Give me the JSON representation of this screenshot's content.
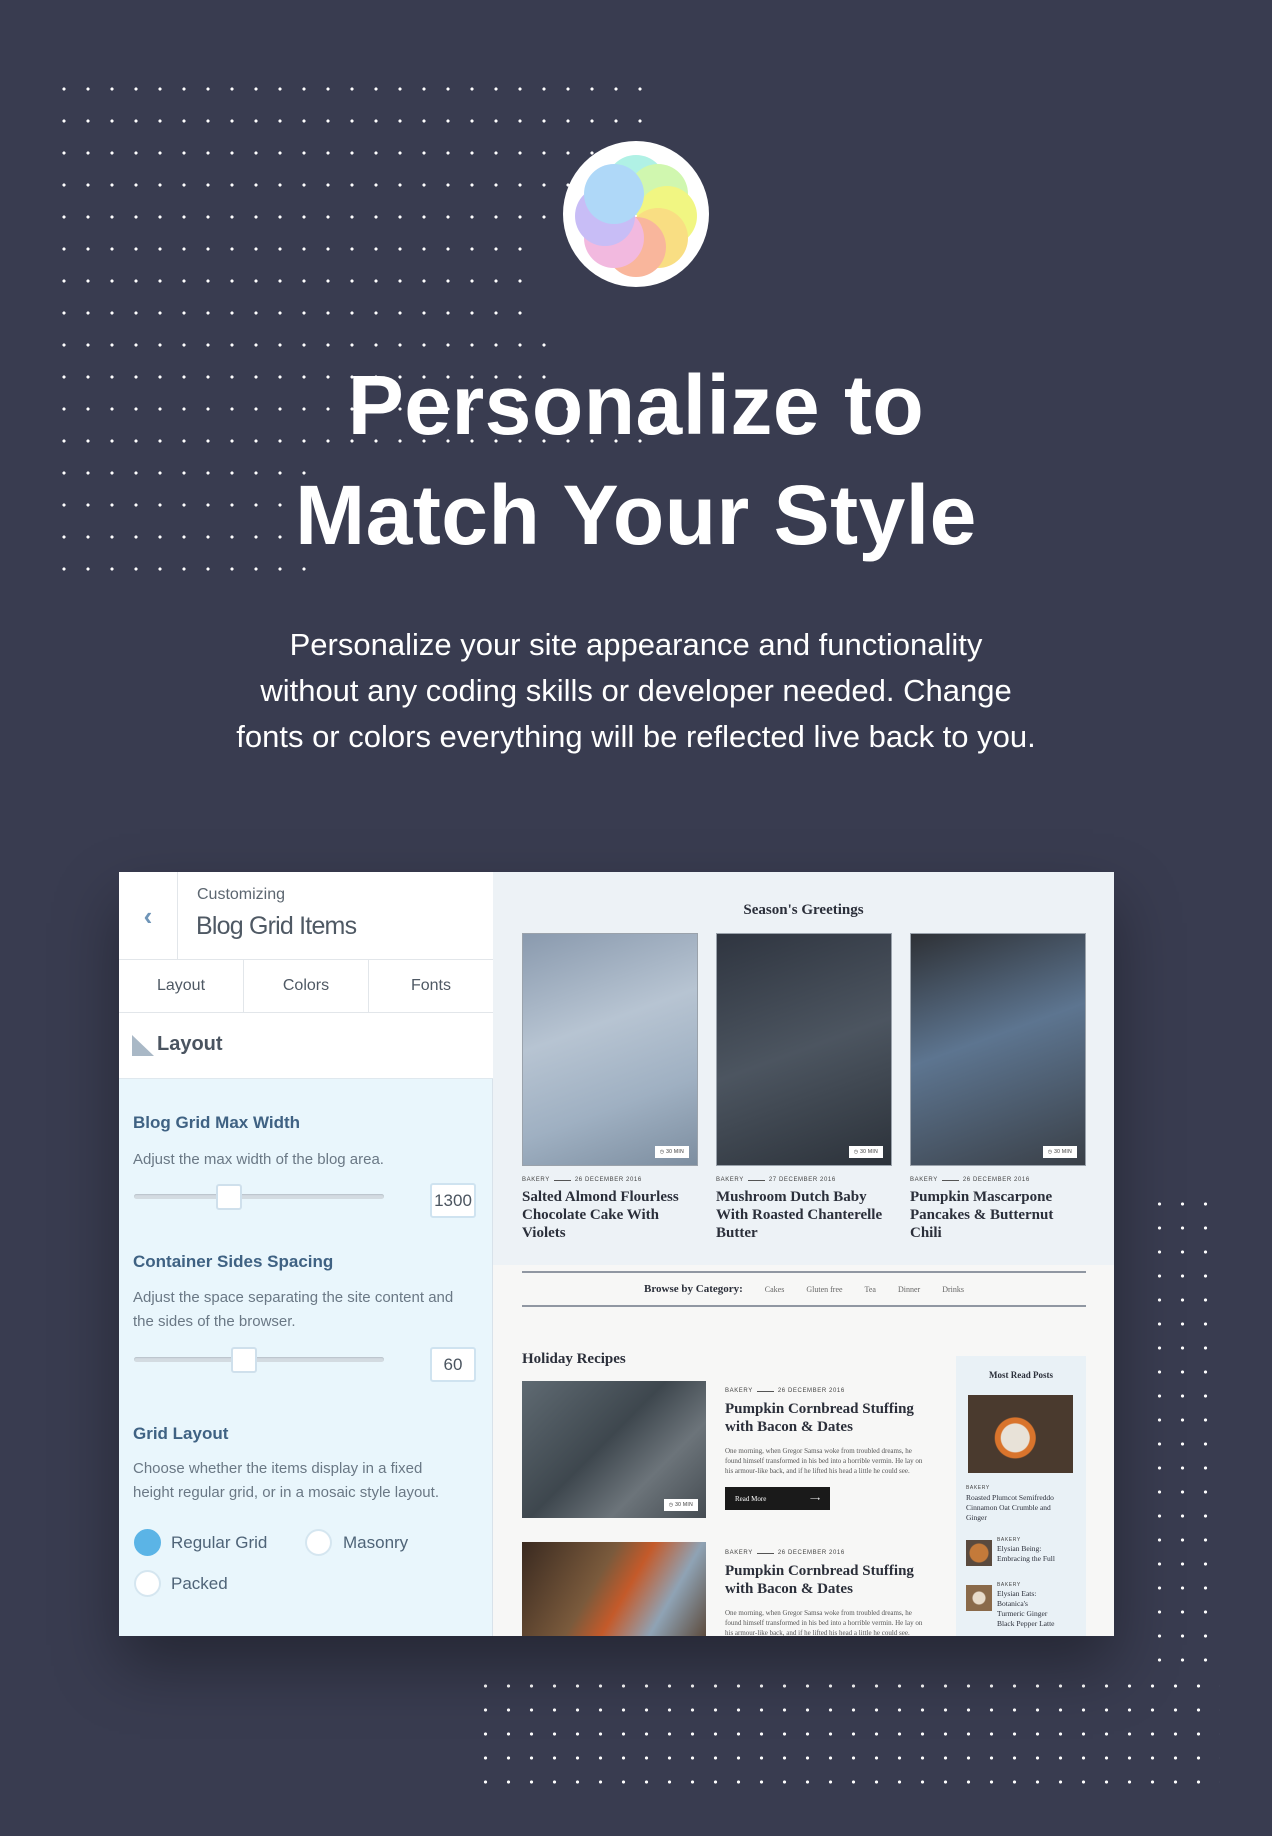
{
  "hero": {
    "logo_icon": "color-flower-icon",
    "title_line1": "Personalize to",
    "title_line2": "Match Your Style",
    "subtitle_line1": "Personalize your site appearance and functionality",
    "subtitle_line2": "without any coding skills or developer needed. Change",
    "subtitle_line3": "fonts or colors everything will be reflected live back to you."
  },
  "colors": {
    "background": "#393c50",
    "accent": "#5bb4e6",
    "heading_blue": "#3f6283"
  },
  "customizer": {
    "back_icon": "chevron-left-icon",
    "context": "Customizing",
    "title": "Blog Grid Items",
    "tabs": [
      "Layout",
      "Colors",
      "Fonts"
    ],
    "section_title": "Layout",
    "section_icon": "ruler-triangle-icon",
    "max_width": {
      "label": "Blog Grid Max Width",
      "desc": "Adjust the max width of the blog area.",
      "value": "1300",
      "slider_fraction": 0.38
    },
    "spacing": {
      "label": "Container Sides Spacing",
      "desc_line1": "Adjust the space separating the site content and",
      "desc_line2": "the sides of the browser.",
      "value": "60",
      "slider_fraction": 0.44
    },
    "grid_layout": {
      "label": "Grid Layout",
      "desc_line1": "Choose whether the items display in a fixed",
      "desc_line2": "height regular grid, or in a mosaic style layout.",
      "options": [
        "Regular Grid",
        "Masonry",
        "Packed"
      ],
      "selected": "Regular Grid"
    }
  },
  "preview": {
    "featured_heading": "Season's Greetings",
    "cards": [
      {
        "category": "BAKERY",
        "date": "26 DECEMBER 2016",
        "time": "30 MIN",
        "title": [
          "Salted Almond Flourless",
          "Chocolate Cake With",
          "Violets"
        ]
      },
      {
        "category": "BAKERY",
        "date": "27 DECEMBER 2016",
        "time": "30 MIN",
        "title": [
          "Mushroom Dutch Baby",
          "With Roasted Chanterelle",
          "Butter"
        ]
      },
      {
        "category": "BAKERY",
        "date": "26 DECEMBER 2016",
        "time": "30 MIN",
        "title": [
          "Pumpkin Mascarpone",
          "Pancakes & Butternut",
          "Chili"
        ]
      }
    ],
    "browse_label": "Browse by Category:",
    "categories": [
      "Cakes",
      "Gluten free",
      "Tea",
      "Dinner",
      "Drinks"
    ],
    "list_heading": "Holiday Recipes",
    "posts": [
      {
        "category": "BAKERY",
        "date": "26 DECEMBER 2016",
        "time": "30 MIN",
        "title": [
          "Pumpkin Cornbread Stuffing",
          "with Bacon & Dates"
        ],
        "body": [
          "One morning, when Gregor Samsa woke from troubled dreams, he",
          "found himself transformed in his bed into a horrible vermin. He lay on",
          "his armour-like back, and if he lifted his head a little he could see."
        ],
        "button": "Read More"
      },
      {
        "category": "BAKERY",
        "date": "26 DECEMBER 2016",
        "title": [
          "Pumpkin Cornbread Stuffing",
          "with Bacon & Dates"
        ],
        "body": [
          "One morning, when Gregor Samsa woke from troubled dreams, he",
          "found himself transformed in his bed into a horrible vermin. He lay on",
          "his armour-like back, and if he lifted his head a little he could see."
        ]
      }
    ],
    "most_read": {
      "heading": "Most Read Posts",
      "featured": {
        "category": "BAKERY",
        "title": [
          "Roasted Plumcot Semifreddo",
          "Cinnamon Oat Crumble and",
          "Ginger"
        ]
      },
      "items": [
        {
          "category": "BAKERY",
          "title": [
            "Elysian Being:",
            "Embracing the Full"
          ]
        },
        {
          "category": "BAKERY",
          "title": [
            "Elysian Eats:",
            "Botanica's",
            "Turmeric Ginger",
            "Black Pepper Latte"
          ]
        }
      ]
    }
  }
}
